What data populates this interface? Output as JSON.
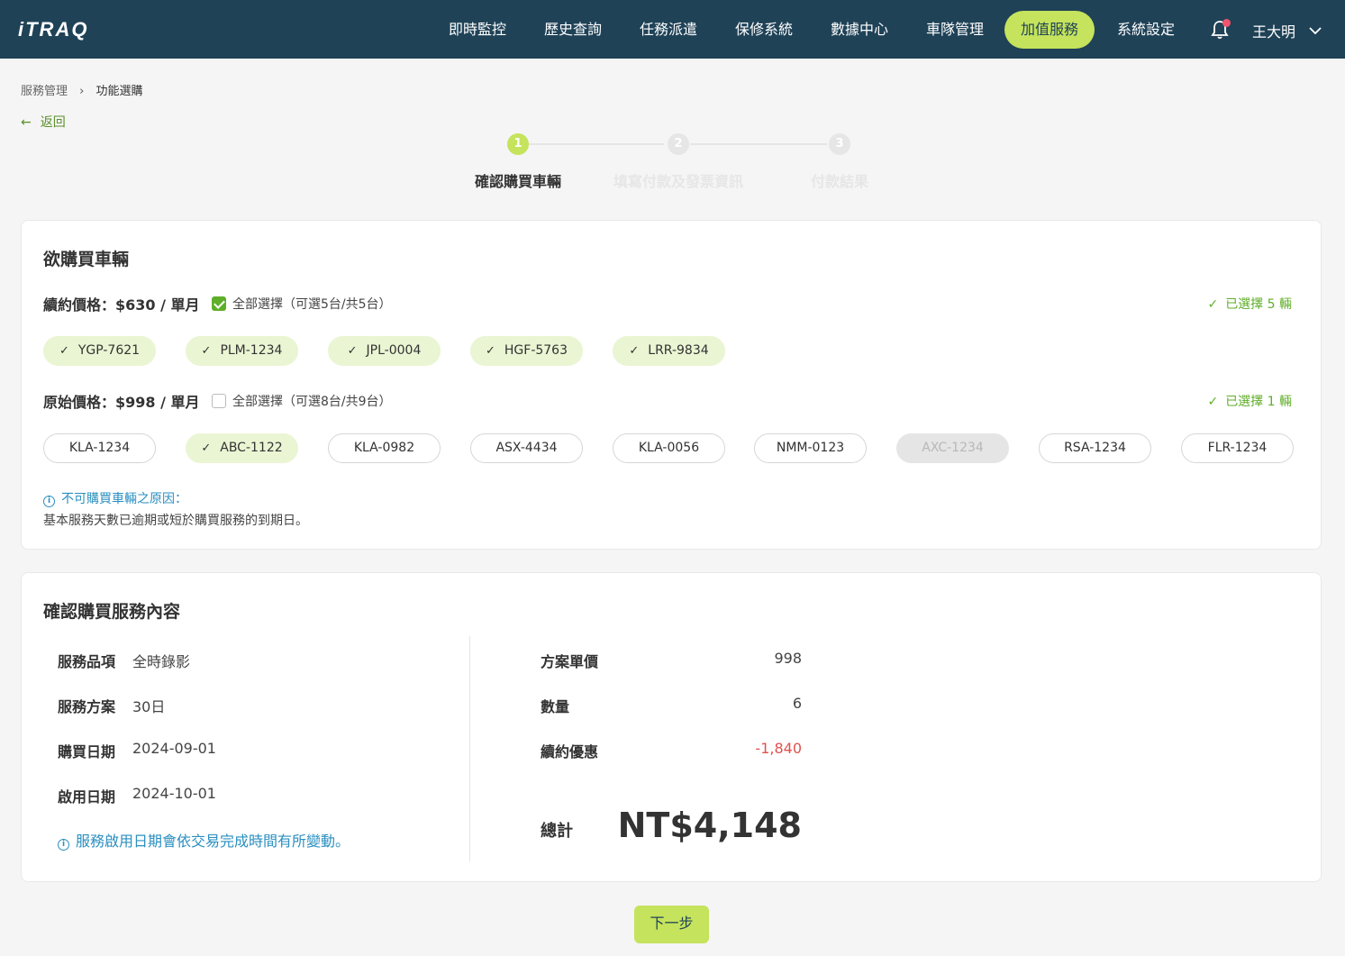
{
  "header": {
    "logo": "iTRAQ",
    "nav": [
      {
        "label": "即時監控",
        "active": false
      },
      {
        "label": "歷史查詢",
        "active": false
      },
      {
        "label": "任務派遣",
        "active": false
      },
      {
        "label": "保修系統",
        "active": false
      },
      {
        "label": "數據中心",
        "active": false
      },
      {
        "label": "車隊管理",
        "active": false
      },
      {
        "label": "加值服務",
        "active": true
      },
      {
        "label": "系統設定",
        "active": false
      }
    ],
    "user_name": "王大明",
    "accent_color": "#c5e35c",
    "bar_color": "#1f4257"
  },
  "breadcrumb": {
    "parent": "服務管理",
    "current": "功能選購"
  },
  "back_label": "返回",
  "stepper": [
    {
      "num": "1",
      "label": "確認購買車輛",
      "state": "current"
    },
    {
      "num": "2",
      "label": "填寫付款及發票資訊",
      "state": "pending"
    },
    {
      "num": "3",
      "label": "付款結果",
      "state": "pending"
    }
  ],
  "vehicles_card": {
    "title": "欲購買車輛",
    "renewal": {
      "price_label": "續約價格：$630 / 單月",
      "check_all_label": "全部選擇（可選5台/共5台）",
      "check_all_checked": true,
      "selected_text": "已選擇 5 輛",
      "plates": [
        {
          "plate": "YGP-7621",
          "state": "selected"
        },
        {
          "plate": "PLM-1234",
          "state": "selected"
        },
        {
          "plate": "JPL-0004",
          "state": "selected"
        },
        {
          "plate": "HGF-5763",
          "state": "selected"
        },
        {
          "plate": "LRR-9834",
          "state": "selected"
        }
      ]
    },
    "original": {
      "price_label": "原始價格：$998 / 單月",
      "check_all_label": "全部選擇（可選8台/共9台）",
      "check_all_checked": false,
      "selected_text": "已選擇 1 輛",
      "plates": [
        {
          "plate": "KLA-1234",
          "state": "unselected"
        },
        {
          "plate": "ABC-1122",
          "state": "selected"
        },
        {
          "plate": "KLA-0982",
          "state": "unselected"
        },
        {
          "plate": "ASX-4434",
          "state": "unselected"
        },
        {
          "plate": "KLA-0056",
          "state": "unselected"
        },
        {
          "plate": "NMM-0123",
          "state": "unselected"
        },
        {
          "plate": "AXC-1234",
          "state": "disabled"
        },
        {
          "plate": "RSA-1234",
          "state": "unselected"
        },
        {
          "plate": "FLR-1234",
          "state": "unselected"
        }
      ]
    },
    "notice_title": "不可購買車輛之原因：",
    "notice_body": "基本服務天數已逾期或短於購買服務的到期日。"
  },
  "summary_card": {
    "title": "確認購買服務內容",
    "left": [
      {
        "label": "服務品項",
        "value": "全時錄影"
      },
      {
        "label": "服務方案",
        "value": "30日"
      },
      {
        "label": "購買日期",
        "value": "2024-09-01"
      },
      {
        "label": "啟用日期",
        "value": "2024-10-01"
      }
    ],
    "note": "服務啟用日期會依交易完成時間有所變動。",
    "right": [
      {
        "label": "方案單價",
        "value": "998",
        "negative": false
      },
      {
        "label": "數量",
        "value": "6",
        "negative": false
      },
      {
        "label": "續約優惠",
        "value": "-1,840",
        "negative": true
      }
    ],
    "total_label": "總計",
    "total_value": "NT$4,148"
  },
  "next_button": "下一步"
}
